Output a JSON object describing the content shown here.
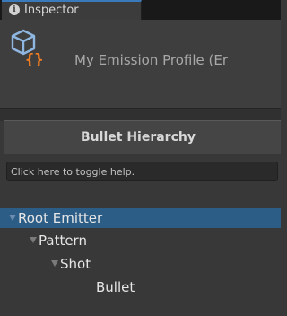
{
  "tab": {
    "label": "Inspector",
    "icon": "info-icon"
  },
  "header": {
    "title": "My Emission Profile (Er",
    "icon": "emission-profile-icon"
  },
  "section": {
    "title": "Bullet Hierarchy"
  },
  "help": {
    "placeholder": "Click here to toggle help."
  },
  "tree": {
    "items": [
      {
        "label": "Root Emitter",
        "expanded": true,
        "selected": true
      },
      {
        "label": "Pattern",
        "expanded": true,
        "selected": false
      },
      {
        "label": "Shot",
        "expanded": true,
        "selected": false
      },
      {
        "label": "Bullet",
        "expanded": false,
        "selected": false
      }
    ]
  },
  "colors": {
    "accent": "#3a79bb",
    "selection": "#2c5d87",
    "icon_orange": "#f07c23",
    "icon_blue": "#8fb6e0"
  }
}
